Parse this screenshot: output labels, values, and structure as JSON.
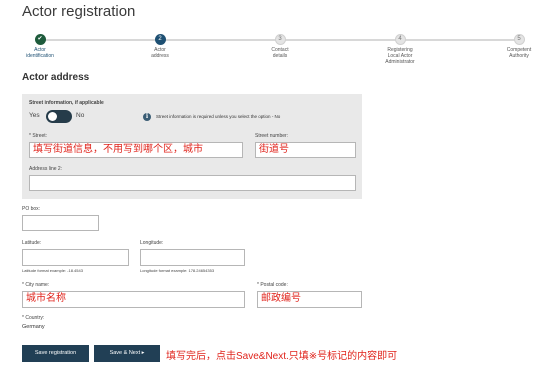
{
  "page": {
    "title": "Actor registration"
  },
  "stepper": {
    "steps": [
      {
        "number": "✔",
        "label_line1": "Actor",
        "label_line2": "identification",
        "label_line3": "",
        "state": "done"
      },
      {
        "number": "2",
        "label_line1": "Actor",
        "label_line2": "address",
        "label_line3": "",
        "state": "active"
      },
      {
        "number": "3",
        "label_line1": "Contact",
        "label_line2": "details",
        "label_line3": "",
        "state": "todo"
      },
      {
        "number": "4",
        "label_line1": "Registering",
        "label_line2": "Local Actor",
        "label_line3": "Administrator",
        "state": "todo"
      },
      {
        "number": "5",
        "label_line1": "Competent",
        "label_line2": "Authority",
        "label_line3": "",
        "state": "todo"
      }
    ]
  },
  "section": {
    "title": "Actor address"
  },
  "street_panel": {
    "heading": "Street information, if applicable",
    "toggle_yes": "Yes",
    "toggle_no": "No",
    "info_icon": "i",
    "info_text": "Street information is required unless you select the option - No",
    "street_label": "* Street:",
    "street_value": "填写街道信息，不用写到哪个区，城市",
    "street_number_label": "Street number:",
    "street_number_value": "街道号",
    "address_line2_label": "Address line 2:",
    "address_line2_value": ""
  },
  "po_box": {
    "label": "PO box:",
    "value": ""
  },
  "latitude": {
    "label": "Latitude:",
    "value": "",
    "hint": "Latitude format example: -18.4543"
  },
  "longitude": {
    "label": "Longitude:",
    "value": "",
    "hint": "Longitude format example: 178.24654353"
  },
  "city": {
    "label": "* City name:",
    "value": "城市名称"
  },
  "postal": {
    "label": "* Postal code:",
    "value": "邮政编号"
  },
  "country": {
    "label": "* Country:",
    "value": "Germany"
  },
  "buttons": {
    "save_registration": "Save registration",
    "save_next": "Save & Next ▸"
  },
  "annotation_note": "填写完后，点击Save&Next.只填※号标记的内容即可",
  "colors": {
    "primary": "#213f55",
    "done_step": "#1e5b3c",
    "annotation": "#e0241c",
    "panel_bg": "#e9e9e9"
  }
}
